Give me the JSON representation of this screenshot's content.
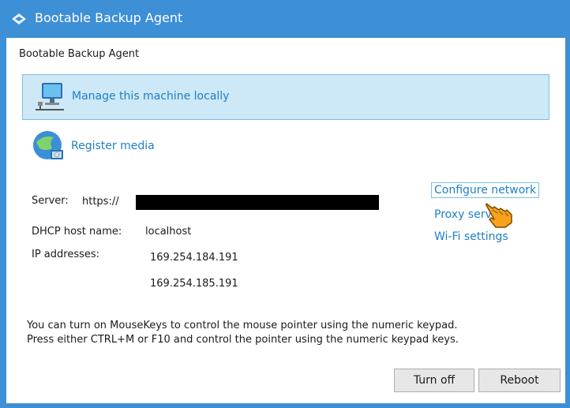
{
  "window": {
    "title": "Bootable Backup Agent"
  },
  "header": {
    "label": "Bootable Backup Agent"
  },
  "menu": {
    "items": [
      {
        "label": "Manage this machine locally",
        "icon": "computer-network-icon",
        "selected": true
      },
      {
        "label": "Register media",
        "icon": "globe-computer-icon",
        "selected": false
      }
    ]
  },
  "info": {
    "server_label": "Server:",
    "server_value": "https://",
    "dhcp_label": "DHCP host name:",
    "dhcp_value": "localhost",
    "ip_label": "IP addresses:",
    "ip_values": [
      "169.254.184.191",
      "169.254.185.191"
    ]
  },
  "links": {
    "configure_network": "Configure network",
    "proxy_server": "Proxy serv",
    "wifi_settings": "Wi-Fi settings"
  },
  "note": {
    "line1": "You can turn on MouseKeys to control the mouse pointer using the numeric keypad.",
    "line2": "Press either CTRL+M or F10 and control the pointer using the numeric keypad keys."
  },
  "buttons": {
    "turn_off": "Turn off",
    "reboot": "Reboot"
  },
  "colors": {
    "accent": "#3d8fd6",
    "link": "#1e7fc6",
    "selected_bg": "#cde8f6"
  }
}
